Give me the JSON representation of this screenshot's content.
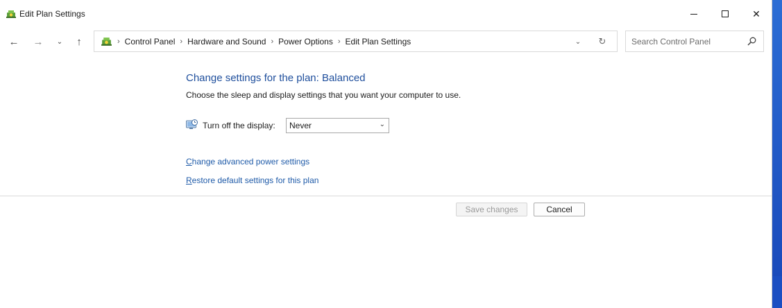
{
  "window": {
    "title": "Edit Plan Settings",
    "minimize_icon": "minimize-icon",
    "maximize_icon": "maximize-icon",
    "close_icon": "close-icon",
    "close_glyph": "✕"
  },
  "nav": {
    "back_glyph": "←",
    "forward_glyph": "→",
    "recent_glyph": "⌄",
    "up_glyph": "↑"
  },
  "breadcrumb": {
    "items": [
      "Control Panel",
      "Hardware and Sound",
      "Power Options",
      "Edit Plan Settings"
    ],
    "separator": "›",
    "dropdown_glyph": "⌄",
    "refresh_glyph": "↻"
  },
  "search": {
    "placeholder": "Search Control Panel",
    "value": ""
  },
  "content": {
    "heading": "Change settings for the plan: Balanced",
    "subtext": "Choose the sleep and display settings that you want your computer to use.",
    "display_label": "Turn off the display:",
    "display_value": "Never",
    "select_chevron": "⌄",
    "link_advanced_first": "C",
    "link_advanced_rest": "hange advanced power settings",
    "link_restore_first": "R",
    "link_restore_rest": "estore default settings for this plan"
  },
  "buttons": {
    "save": "Save changes",
    "cancel": "Cancel"
  },
  "colors": {
    "heading": "#1e4e9c",
    "link": "#1e5aa8",
    "disabled_text": "#9a9a9a"
  }
}
